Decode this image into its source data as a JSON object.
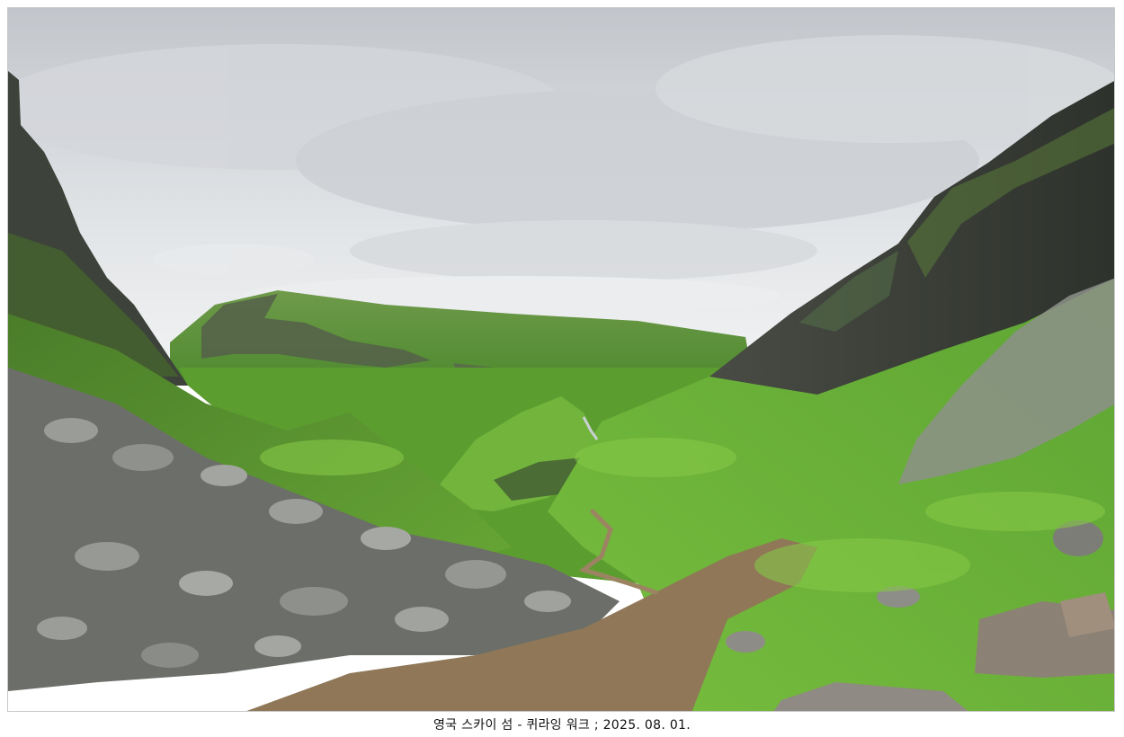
{
  "caption": "영국 스카이 섬 - 퀴라잉 워크 ; 2025. 08. 01.",
  "scene": {
    "subject": "quiraing-valley",
    "colors": {
      "sky_top": "#c9ccd0",
      "sky_bottom": "#eef0f2",
      "cloud": "#f4f5f6",
      "cliff_dark": "#3b3f38",
      "grass_bright": "#6fb63a",
      "grass_mid": "#4f8f2c",
      "grass_dark": "#2f5a1f",
      "rock": "#8a8a86",
      "path": "#9c8463"
    }
  }
}
